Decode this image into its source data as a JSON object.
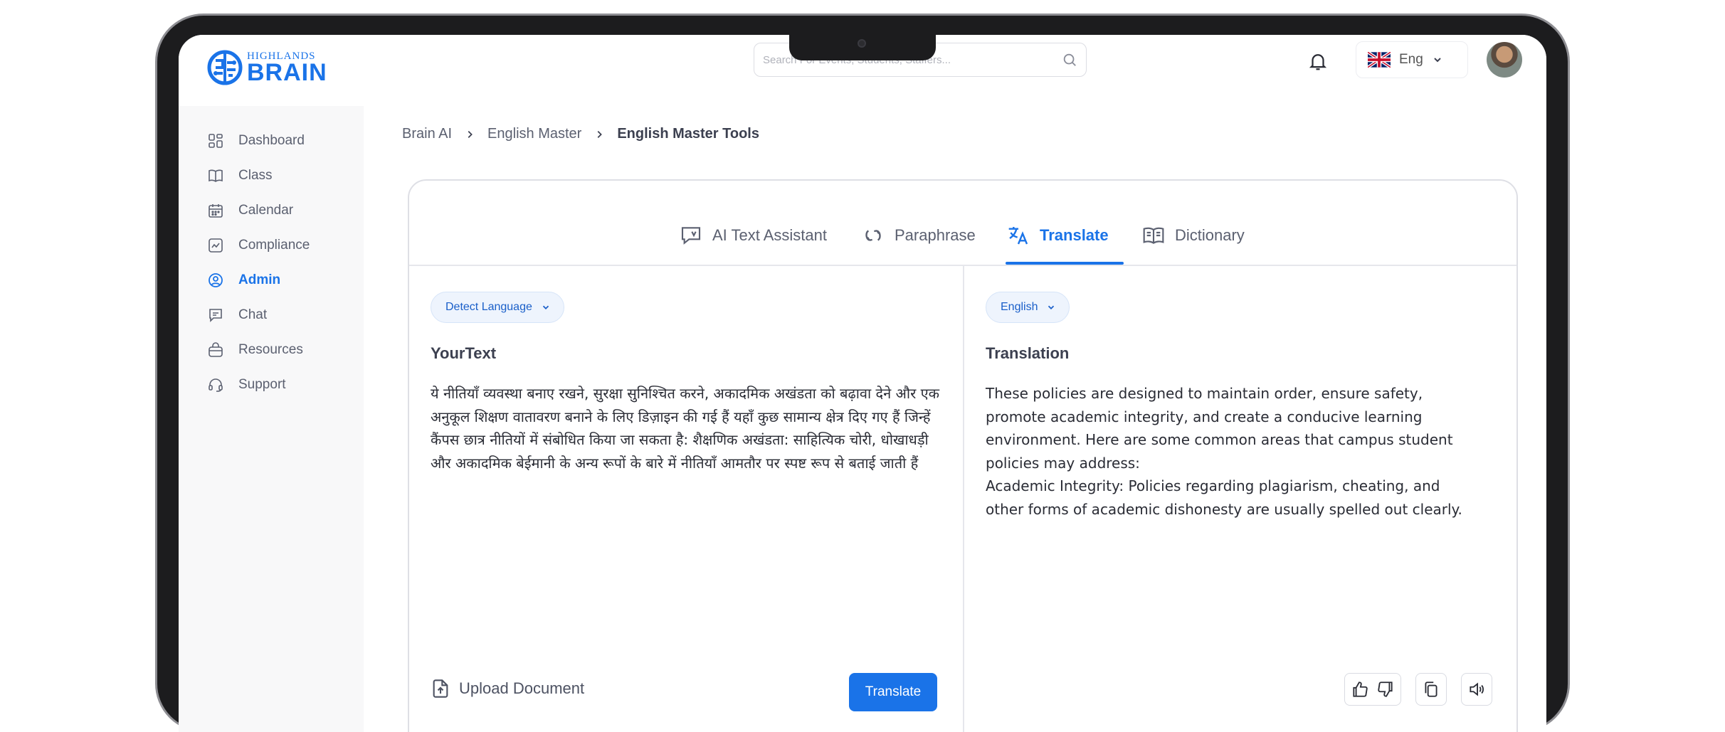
{
  "brand": {
    "small": "HIGHLANDS",
    "large": "BRAIN",
    "color": "#1a73e8"
  },
  "search": {
    "placeholder": "Search For Events, Students, Staffers..."
  },
  "language": {
    "selected": "Eng"
  },
  "sidebar": {
    "items": [
      {
        "label": "Dashboard",
        "icon": "dashboard-icon"
      },
      {
        "label": "Class",
        "icon": "book-icon"
      },
      {
        "label": "Calendar",
        "icon": "calendar-icon"
      },
      {
        "label": "Compliance",
        "icon": "chart-icon"
      },
      {
        "label": "Admin",
        "icon": "admin-icon",
        "active": true
      },
      {
        "label": "Chat",
        "icon": "chat-icon"
      },
      {
        "label": "Resources",
        "icon": "resources-icon"
      },
      {
        "label": "Support",
        "icon": "headset-icon"
      }
    ]
  },
  "breadcrumb": [
    "Brain AI",
    "English Master",
    "English Master Tools"
  ],
  "tabs": [
    {
      "label": "AI Text Assistant",
      "icon": "text-assistant-icon"
    },
    {
      "label": "Paraphrase",
      "icon": "paraphrase-icon"
    },
    {
      "label": "Translate",
      "icon": "translate-icon",
      "active": true
    },
    {
      "label": "Dictionary",
      "icon": "dictionary-icon"
    }
  ],
  "source": {
    "language_select": "Detect Language",
    "title": "YourText",
    "text": "ये नीतियाँ व्यवस्था बनाए रखने, सुरक्षा सुनिश्चित करने, अकादमिक अखंडता को बढ़ावा देने और एक अनुकूल शिक्षण वातावरण बनाने के लिए डिज़ाइन की गई हैं   यहाँ कुछ सामान्य क्षेत्र दिए गए हैं जिन्हें कैंपस छात्र नीतियों में संबोधित किया जा सकता है: शैक्षणिक अखंडता: साहित्यिक चोरी, धोखाधड़ी और अकादमिक बेईमानी के अन्य रूपों के बारे में नीतियाँ आमतौर पर स्पष्ट रूप से बताई जाती हैं",
    "upload_label": "Upload Document",
    "translate_button": "Translate"
  },
  "target": {
    "language_select": "English",
    "title": "Translation",
    "lines": [
      "These policies are designed to maintain order, ensure safety,",
      "promote academic integrity, and create a conducive learning",
      "environment. Here are some common areas that campus student",
      "policies may address:",
      "Academic Integrity: Policies regarding plagiarism, cheating, and",
      "other forms of academic dishonesty are usually spelled out clearly."
    ]
  }
}
